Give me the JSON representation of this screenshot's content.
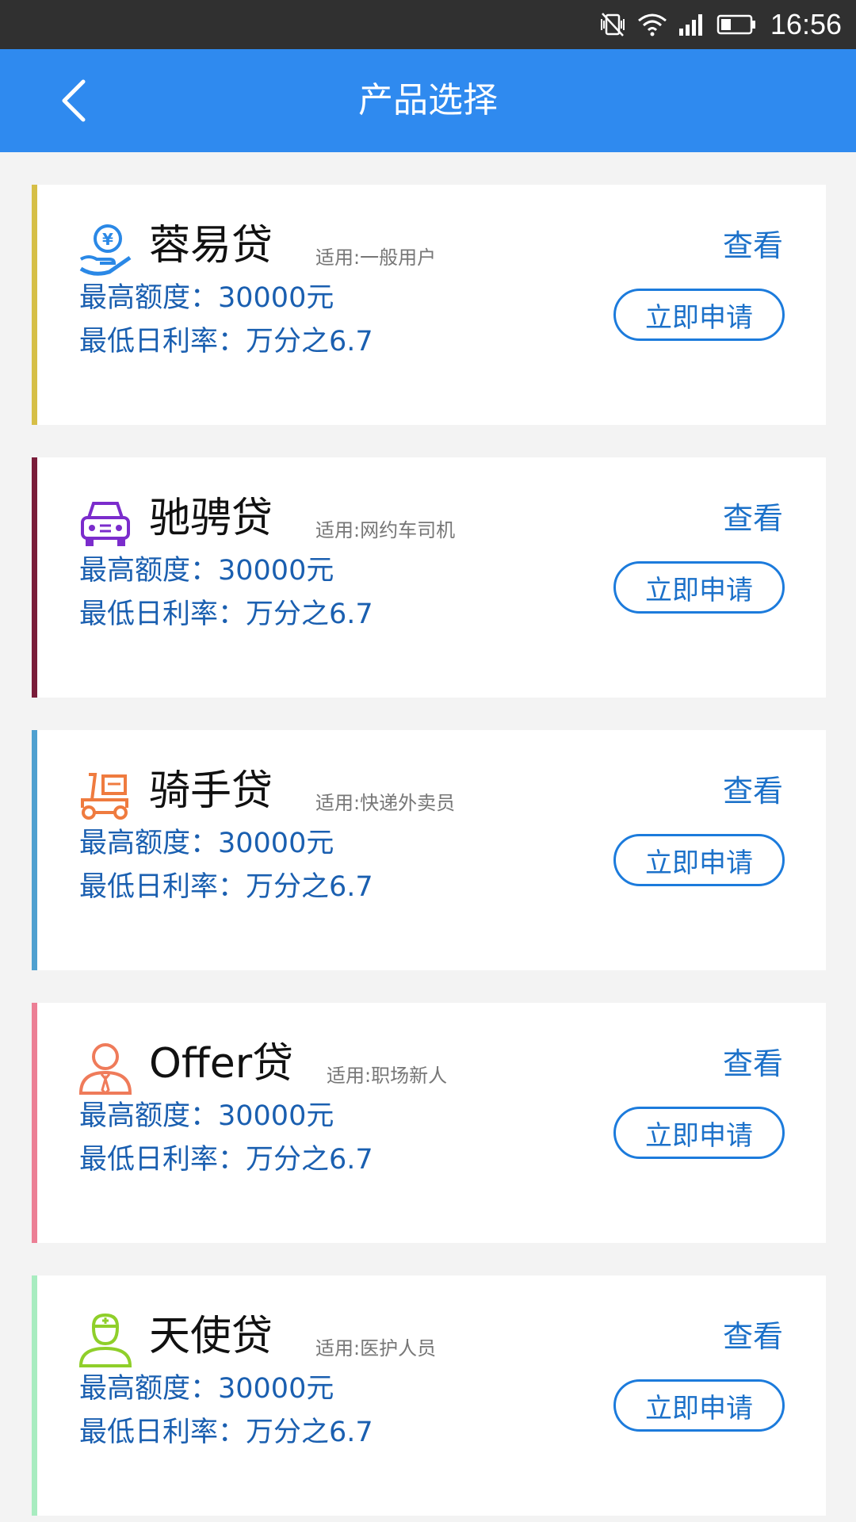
{
  "status_bar": {
    "time": "16:56",
    "icons": [
      "vibrate-off-icon",
      "wifi-icon",
      "signal-icon",
      "battery-icon"
    ]
  },
  "header": {
    "title": "产品选择",
    "back_icon": "chevron-left-icon"
  },
  "products": [
    {
      "name": "蓉易贷",
      "scope": "适用:一般用户",
      "max_limit": "最高额度：30000元",
      "min_rate": "最低日利率：万分之6.7",
      "view_label": "查看",
      "apply_label": "立即申请",
      "icon": "hand-yuan-icon",
      "accent_color": "#d6bf47",
      "icon_color": "#2a88e6"
    },
    {
      "name": "驰骋贷",
      "scope": "适用:网约车司机",
      "max_limit": "最高额度：30000元",
      "min_rate": "最低日利率：万分之6.7",
      "view_label": "查看",
      "apply_label": "立即申请",
      "icon": "car-icon",
      "accent_color": "#7a1d3a",
      "icon_color": "#7b2ccc"
    },
    {
      "name": "骑手贷",
      "scope": "适用:快递外卖员",
      "max_limit": "最高额度：30000元",
      "min_rate": "最低日利率：万分之6.7",
      "view_label": "查看",
      "apply_label": "立即申请",
      "icon": "delivery-scooter-icon",
      "accent_color": "#4fa0d0",
      "icon_color": "#ef7b3f"
    },
    {
      "name": "Offer贷",
      "scope": "适用:职场新人",
      "max_limit": "最高额度：30000元",
      "min_rate": "最低日利率：万分之6.7",
      "view_label": "查看",
      "apply_label": "立即申请",
      "icon": "office-worker-icon",
      "accent_color": "#ec7f95",
      "icon_color": "#ef7b5a"
    },
    {
      "name": "天使贷",
      "scope": "适用:医护人员",
      "max_limit": "最高额度：30000元",
      "min_rate": "最低日利率：万分之6.7",
      "view_label": "查看",
      "apply_label": "立即申请",
      "icon": "nurse-icon",
      "accent_color": "#a8ecc0",
      "icon_color": "#8fcf2a"
    }
  ]
}
